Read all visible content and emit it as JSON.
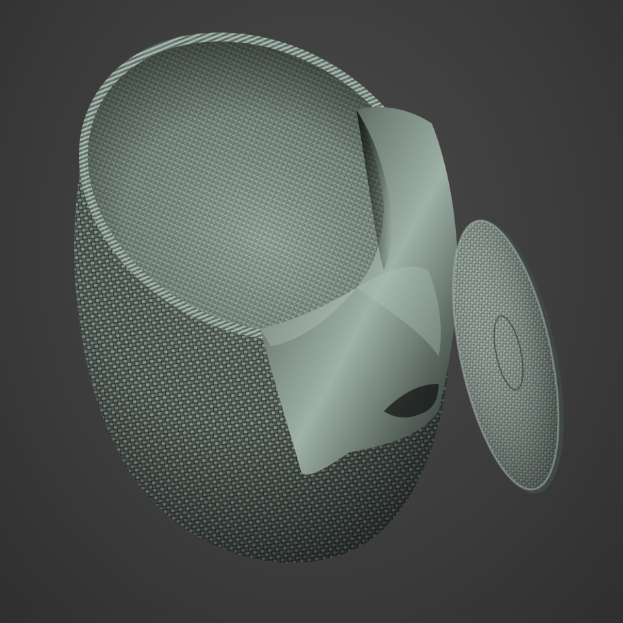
{
  "scene": {
    "background_color": "#3d3d3d",
    "material_color": "#7f8f86",
    "objects": [
      "woven-basket",
      "draped-cloth",
      "woven-lid"
    ]
  }
}
